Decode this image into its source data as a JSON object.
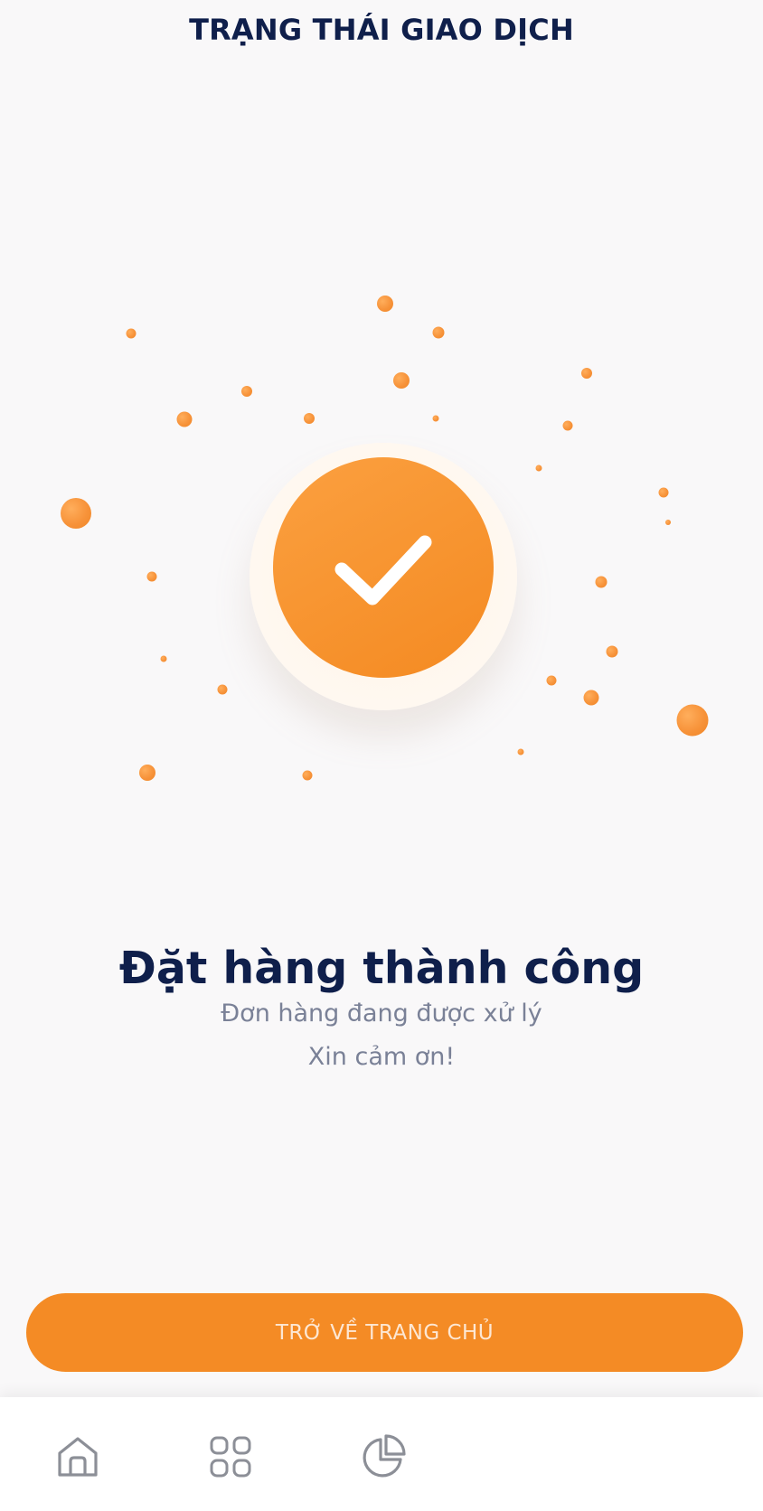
{
  "header": {
    "title": "TRẠNG THÁI GIAO DỊCH"
  },
  "status": {
    "icon": "check-icon",
    "title": "Đặt hàng thành công",
    "subtitle": "Đơn hàng đang được xử lý",
    "thanks": "Xin cảm ơn!"
  },
  "actions": {
    "home_button_label": "TRỞ VỀ TRANG CHỦ"
  },
  "bottom_nav": {
    "items": [
      {
        "icon": "home-icon"
      },
      {
        "icon": "apps-grid-icon"
      },
      {
        "icon": "pie-chart-icon"
      }
    ]
  },
  "colors": {
    "accent": "#f48b25",
    "title": "#0f1f4b",
    "subtitle": "#7a8197",
    "background": "#f9f8f9"
  }
}
